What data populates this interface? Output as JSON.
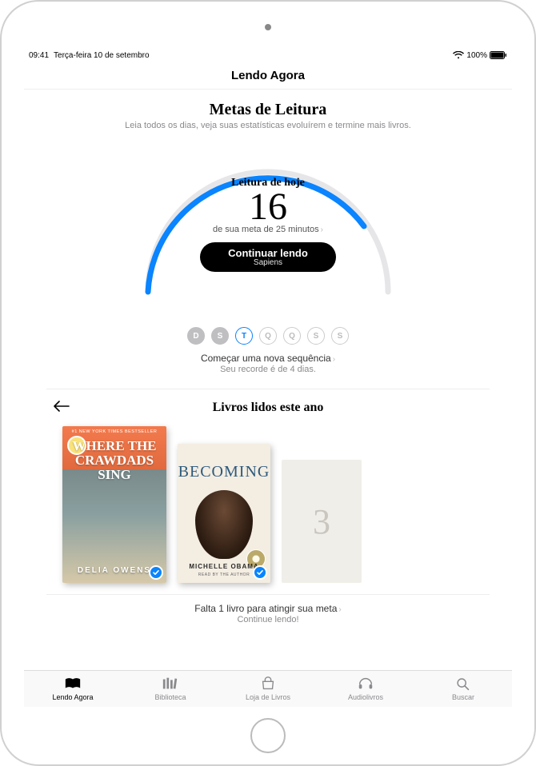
{
  "status": {
    "time": "09:41",
    "date": "Terça-feira 10 de setembro",
    "battery_pct": "100%"
  },
  "nav": {
    "title": "Lendo Agora"
  },
  "goals": {
    "heading": "Metas de Leitura",
    "sub": "Leia todos os dias, veja suas estatísticas evoluírem e termine mais livros.",
    "today_label": "Leitura de hoje",
    "today_minutes": "16",
    "target_text": "de sua meta de 25 minutos",
    "continue_label": "Continuar lendo",
    "continue_book": "Sapiens",
    "days": [
      {
        "letter": "D",
        "state": "filled"
      },
      {
        "letter": "S",
        "state": "filled"
      },
      {
        "letter": "T",
        "state": "today"
      },
      {
        "letter": "Q",
        "state": "empty"
      },
      {
        "letter": "Q",
        "state": "empty"
      },
      {
        "letter": "S",
        "state": "empty"
      },
      {
        "letter": "S",
        "state": "empty"
      }
    ],
    "streak_line1": "Começar uma nova sequência",
    "streak_line2": "Seu recorde é de 4 dias."
  },
  "books": {
    "heading": "Livros lidos este ano",
    "items": [
      {
        "bestseller": "#1 NEW YORK TIMES BESTSELLER",
        "title": "WHERE THE CRAWDADS SING",
        "author": "DELIA OWENS"
      },
      {
        "title": "BECOMING",
        "author": "MICHELLE OBAMA",
        "sub": "READ BY THE AUTHOR"
      }
    ],
    "placeholder_number": "3",
    "goal_line1": "Falta 1 livro para atingir sua meta",
    "goal_line2": "Continue lendo!"
  },
  "tabs": [
    {
      "label": "Lendo Agora",
      "active": true
    },
    {
      "label": "Biblioteca",
      "active": false
    },
    {
      "label": "Loja de Livros",
      "active": false
    },
    {
      "label": "Audiolivros",
      "active": false
    },
    {
      "label": "Buscar",
      "active": false
    }
  ]
}
